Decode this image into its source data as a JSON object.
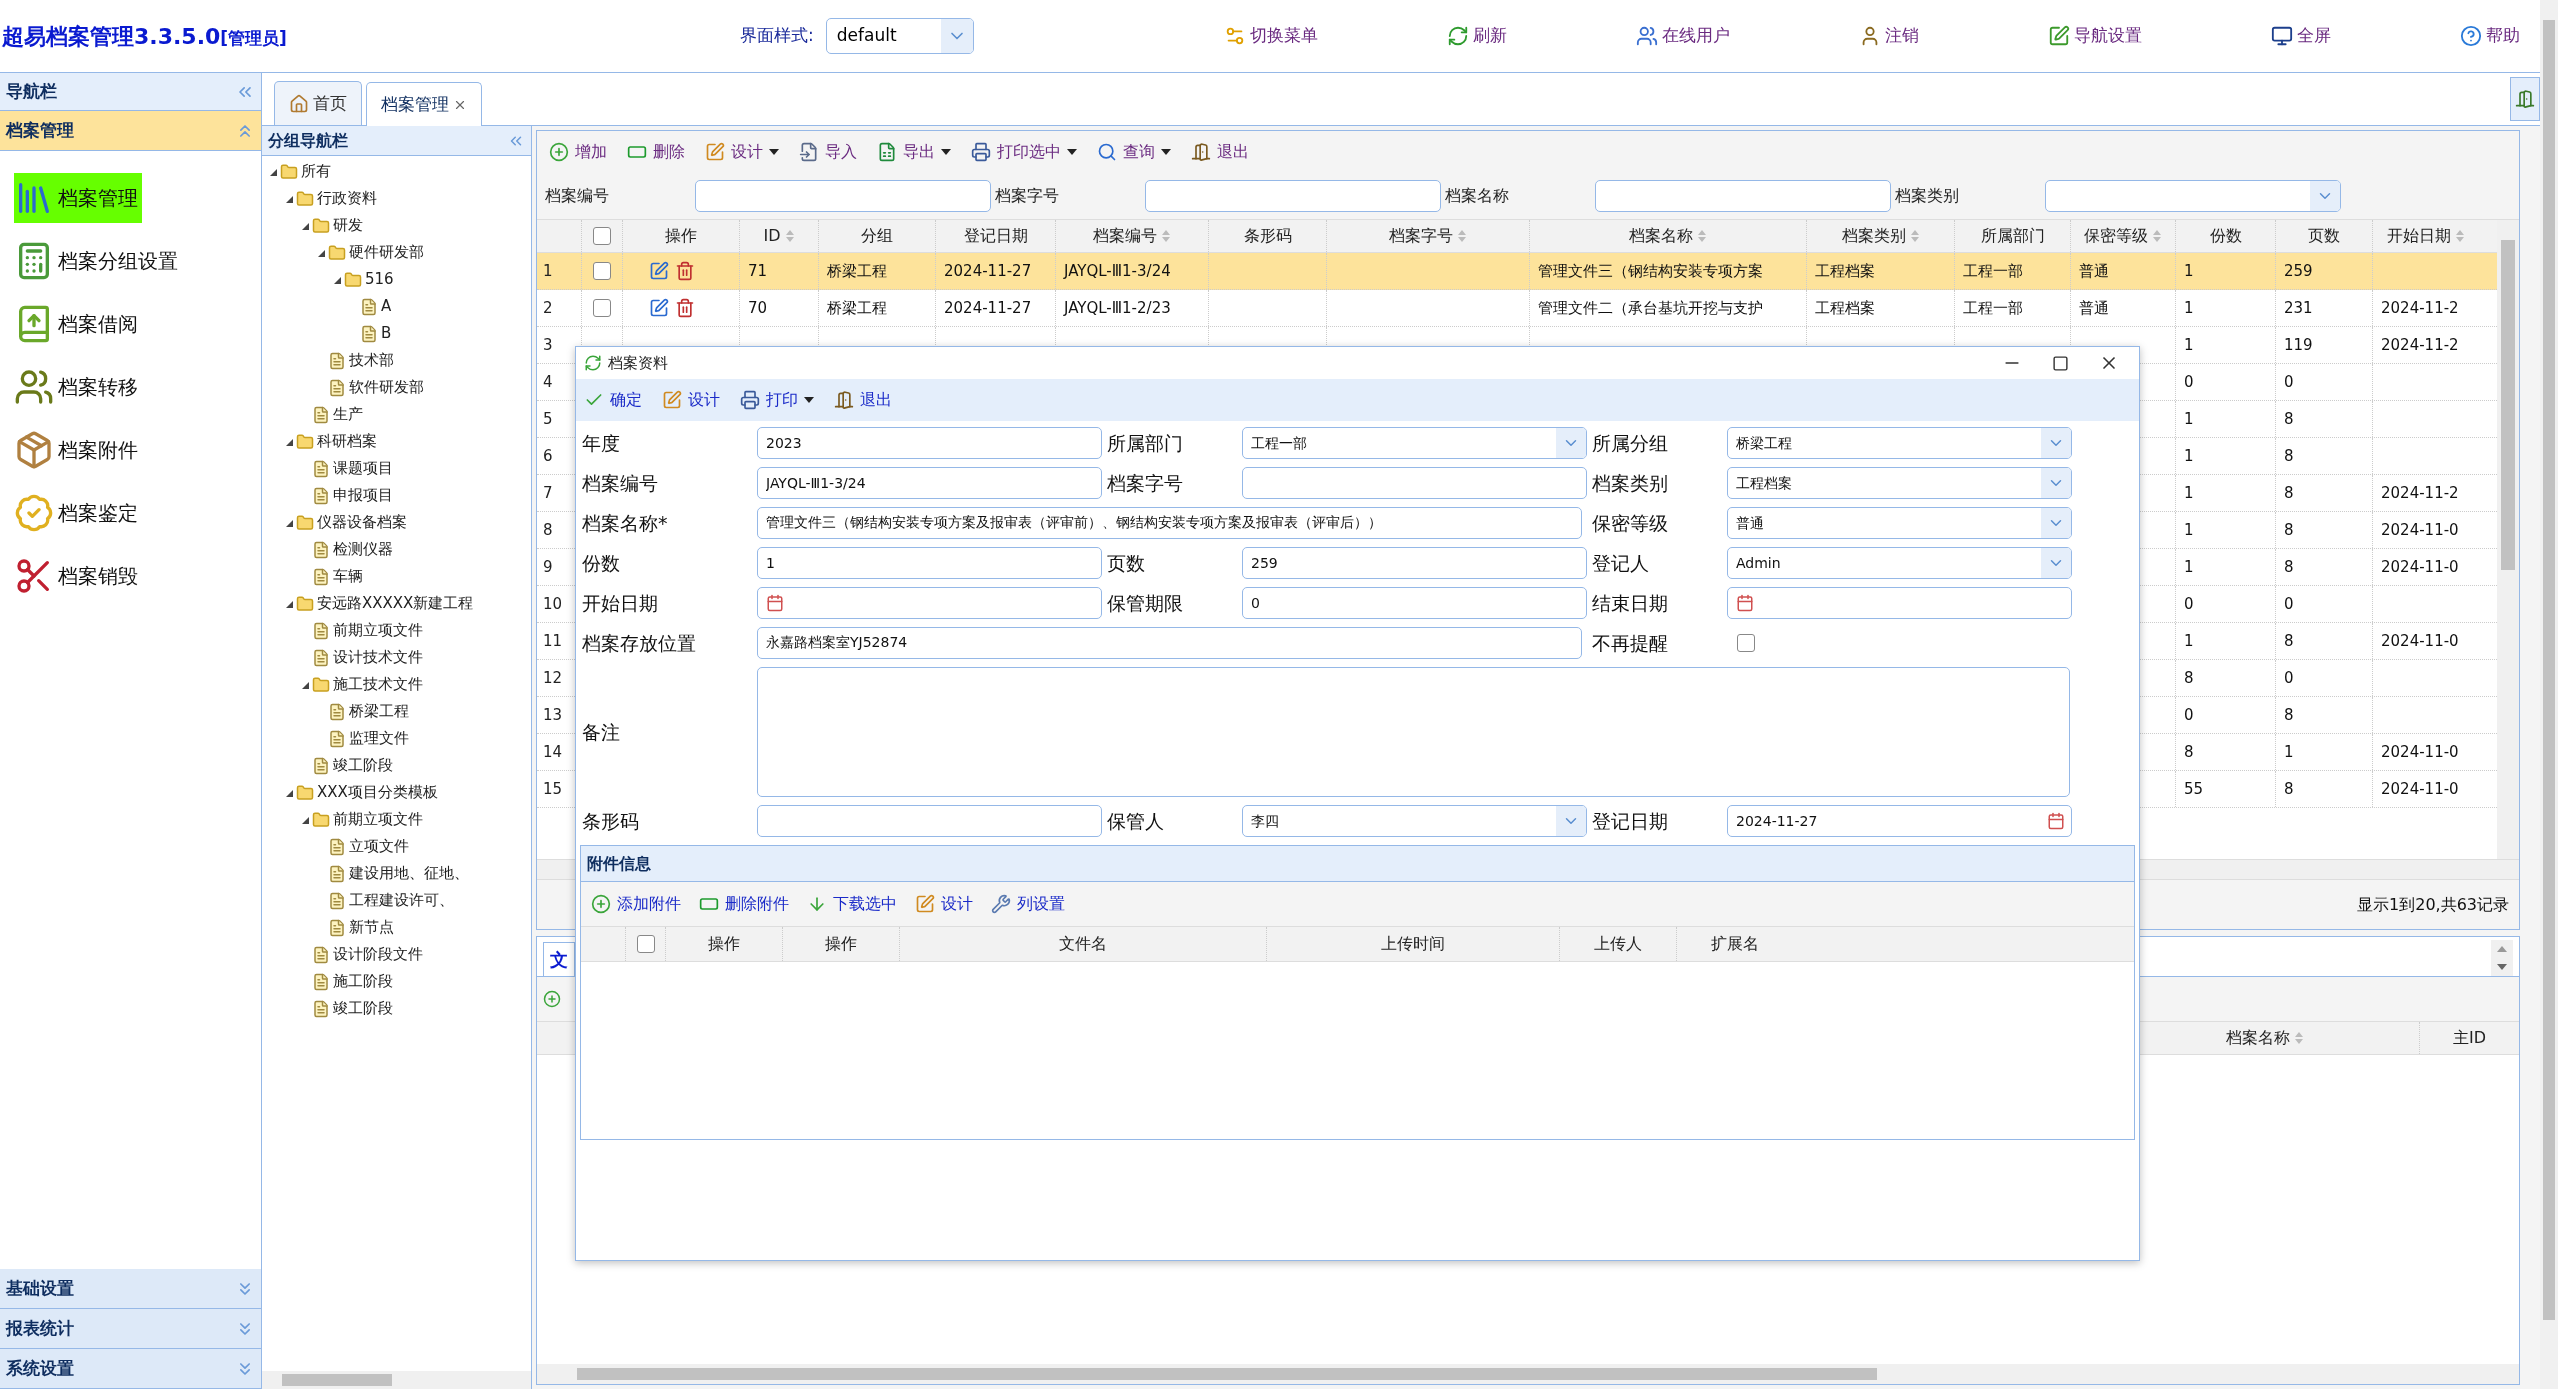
{
  "app": {
    "title": "超易档案管理3.3.5.0",
    "role": "[管理员]"
  },
  "theme_selector": {
    "label": "界面样式:",
    "value": "default"
  },
  "top_toolbar": [
    "切换菜单",
    "刷新",
    "在线用户",
    "注销",
    "导航设置",
    "全屏",
    "帮助"
  ],
  "sidebar": {
    "title": "导航栏",
    "sections": [
      {
        "title": "档案管理",
        "expanded": true,
        "items": [
          {
            "label": "档案管理",
            "selected": true
          },
          {
            "label": "档案分组设置",
            "selected": false
          },
          {
            "label": "档案借阅",
            "selected": false
          },
          {
            "label": "档案转移",
            "selected": false
          },
          {
            "label": "档案附件",
            "selected": false
          },
          {
            "label": "档案鉴定",
            "selected": false
          },
          {
            "label": "档案销毁",
            "selected": false
          }
        ]
      },
      {
        "title": "基础设置",
        "expanded": false
      },
      {
        "title": "报表统计",
        "expanded": false
      },
      {
        "title": "系统设置",
        "expanded": false
      }
    ]
  },
  "tabs": [
    {
      "label": "首页",
      "selected": false
    },
    {
      "label": "档案管理",
      "selected": true,
      "closable": true
    }
  ],
  "group_nav": {
    "title": "分组导航栏",
    "tree": [
      {
        "label": "所有",
        "expanded": true,
        "children": [
          {
            "label": "行政资料",
            "expanded": true,
            "children": [
              {
                "label": "研发",
                "expanded": true,
                "children": [
                  {
                    "label": "硬件研发部",
                    "expanded": true,
                    "children": [
                      {
                        "label": "516",
                        "expanded": true,
                        "children": [
                          {
                            "label": "A"
                          },
                          {
                            "label": "B"
                          }
                        ]
                      }
                    ]
                  },
                  {
                    "label": "技术部"
                  },
                  {
                    "label": "软件研发部"
                  }
                ]
              },
              {
                "label": "生产"
              }
            ]
          },
          {
            "label": "科研档案",
            "expanded": true,
            "children": [
              {
                "label": "课题项目"
              },
              {
                "label": "申报项目"
              }
            ]
          },
          {
            "label": "仪器设备档案",
            "expanded": true,
            "children": [
              {
                "label": "检测仪器"
              },
              {
                "label": "车辆"
              }
            ]
          },
          {
            "label": "安远路XXXXX新建工程",
            "expanded": true,
            "children": [
              {
                "label": "前期立项文件"
              },
              {
                "label": "设计技术文件"
              },
              {
                "label": "施工技术文件",
                "expanded": true,
                "children": [
                  {
                    "label": "桥梁工程"
                  },
                  {
                    "label": "监理文件"
                  }
                ]
              },
              {
                "label": "竣工阶段"
              }
            ]
          },
          {
            "label": "XXX项目分类模板",
            "expanded": true,
            "children": [
              {
                "label": "前期立项文件",
                "expanded": true,
                "children": [
                  {
                    "label": "立项文件"
                  },
                  {
                    "label": "建设用地、征地、"
                  },
                  {
                    "label": "工程建设许可、"
                  },
                  {
                    "label": "新节点"
                  }
                ]
              },
              {
                "label": "设计阶段文件"
              },
              {
                "label": "施工阶段"
              },
              {
                "label": "竣工阶段"
              }
            ]
          }
        ]
      }
    ]
  },
  "toolbar": [
    {
      "label": "增加",
      "dropdown": false
    },
    {
      "label": "删除",
      "dropdown": false
    },
    {
      "label": "设计",
      "dropdown": true
    },
    {
      "label": "导入",
      "dropdown": false
    },
    {
      "label": "导出",
      "dropdown": true
    },
    {
      "label": "打印选中",
      "dropdown": true
    },
    {
      "label": "查询",
      "dropdown": true
    },
    {
      "label": "退出",
      "dropdown": false
    }
  ],
  "search": [
    {
      "label": "档案编号",
      "kind": "text"
    },
    {
      "label": "档案字号",
      "kind": "text"
    },
    {
      "label": "档案名称",
      "kind": "text"
    },
    {
      "label": "档案类别",
      "kind": "select"
    }
  ],
  "grid": {
    "header_checked": false,
    "columns": [
      {
        "label": "操作",
        "sortable": false
      },
      {
        "label": "ID",
        "sortable": true
      },
      {
        "label": "分组",
        "sortable": false
      },
      {
        "label": "登记日期",
        "sortable": false
      },
      {
        "label": "档案编号",
        "sortable": true
      },
      {
        "label": "条形码",
        "sortable": false
      },
      {
        "label": "档案字号",
        "sortable": true
      },
      {
        "label": "档案名称",
        "sortable": true
      },
      {
        "label": "档案类别",
        "sortable": true
      },
      {
        "label": "所属部门",
        "sortable": false
      },
      {
        "label": "保密等级",
        "sortable": true
      },
      {
        "label": "份数",
        "sortable": false
      },
      {
        "label": "页数",
        "sortable": false
      },
      {
        "label": "开始日期",
        "sortable": true
      }
    ],
    "rows": [
      {
        "number": "1",
        "selected": true,
        "checked": false,
        "id": "71",
        "group": "桥梁工程",
        "reg_date": "2024-11-27",
        "archive_no": "JAYQL-Ⅲ1-3/24",
        "archive_name": "管理文件三（钢结构安装专项方案",
        "category": "工程档案",
        "department": "工程一部",
        "secrecy": "普通",
        "copies": "1",
        "pages": "259"
      },
      {
        "number": "2",
        "selected": false,
        "checked": false,
        "id": "70",
        "group": "桥梁工程",
        "reg_date": "2024-11-27",
        "archive_no": "JAYQL-Ⅲ1-2/23",
        "archive_name": "管理文件二（承台基坑开挖与支护",
        "category": "工程档案",
        "department": "工程一部",
        "secrecy": "普通",
        "copies": "1",
        "pages": "231",
        "start_date": "2024-11-2"
      },
      {
        "number": "3",
        "selected": false,
        "copies": "1",
        "pages": "119",
        "start_date": "2024-11-2"
      },
      {
        "number": "4",
        "selected": false,
        "copies": "0",
        "pages": "0"
      },
      {
        "number": "5",
        "selected": false,
        "copies": "1",
        "pages": "8"
      },
      {
        "number": "6",
        "selected": false,
        "copies": "1",
        "pages": "8"
      },
      {
        "number": "7",
        "selected": false,
        "copies": "1",
        "pages": "8",
        "start_date": "2024-11-2"
      },
      {
        "number": "8",
        "selected": false,
        "copies": "1",
        "pages": "8",
        "start_date": "2024-11-0"
      },
      {
        "number": "9",
        "selected": false,
        "copies": "1",
        "pages": "8",
        "start_date": "2024-11-0"
      },
      {
        "number": "10",
        "selected": false,
        "copies": "0",
        "pages": "0"
      },
      {
        "number": "11",
        "selected": false,
        "copies": "1",
        "pages": "8",
        "start_date": "2024-11-0"
      },
      {
        "number": "12",
        "selected": false,
        "copies": "8",
        "pages": "0"
      },
      {
        "number": "13",
        "selected": false,
        "copies": "0",
        "pages": "8"
      },
      {
        "number": "14",
        "selected": false,
        "copies": "8",
        "pages": "1",
        "start_date": "2024-11-0"
      },
      {
        "number": "15",
        "selected": false,
        "copies": "55",
        "pages": "8",
        "start_date": "2024-11-0"
      }
    ],
    "pager": "显示1到20,共63记录"
  },
  "lower_panel": {
    "tab": "文",
    "columns": [
      {
        "label": "档案名称",
        "sortable": true
      },
      {
        "label": "主ID",
        "sortable": false
      }
    ]
  },
  "dialog": {
    "title": "档案资料",
    "toolbar": [
      {
        "label": "确定",
        "dropdown": false
      },
      {
        "label": "设计",
        "dropdown": false
      },
      {
        "label": "打印",
        "dropdown": true
      },
      {
        "label": "退出",
        "dropdown": false
      }
    ],
    "fields": [
      {
        "label": "年度",
        "kind": "text",
        "value": "2023"
      },
      {
        "label": "所属部门",
        "kind": "select",
        "value": "工程一部"
      },
      {
        "label": "所属分组",
        "kind": "select",
        "value": "桥梁工程"
      },
      {
        "label": "档案编号",
        "kind": "text",
        "value": "JAYQL-Ⅲ1-3/24"
      },
      {
        "label": "档案字号",
        "kind": "text"
      },
      {
        "label": "档案类别",
        "kind": "select",
        "value": "工程档案"
      },
      {
        "label": "档案名称*",
        "kind": "wide",
        "value": "管理文件三（钢结构安装专项方案及报审表（评审前）、钢结构安装专项方案及报审表（评审后））"
      },
      {
        "label": "保密等级",
        "kind": "select",
        "value": "普通"
      },
      {
        "label": "份数",
        "kind": "text",
        "value": "1"
      },
      {
        "label": "页数",
        "kind": "text",
        "value": "259"
      },
      {
        "label": "登记人",
        "kind": "select",
        "value": "Admin"
      },
      {
        "label": "开始日期",
        "kind": "date"
      },
      {
        "label": "保管期限",
        "kind": "text",
        "value": "0"
      },
      {
        "label": "结束日期",
        "kind": "date"
      },
      {
        "label": "档案存放位置",
        "kind": "wide",
        "value": "永嘉路档案室YJ52874"
      },
      {
        "label": "不再提醒",
        "kind": "checkbox",
        "checked": false
      },
      {
        "label": "备注",
        "kind": "textarea"
      },
      {
        "label": "条形码",
        "kind": "text"
      },
      {
        "label": "保管人",
        "kind": "select",
        "value": "李四"
      },
      {
        "label": "登记日期",
        "kind": "date",
        "value": "2024-11-27"
      }
    ],
    "attachments": {
      "title": "附件信息",
      "header_checked": false,
      "toolbar": [
        "添加附件",
        "删除附件",
        "下载选中",
        "设计",
        "列设置"
      ],
      "columns": [
        "操作",
        "操作",
        "文件名",
        "上传时间",
        "上传人",
        "扩展名"
      ]
    }
  }
}
